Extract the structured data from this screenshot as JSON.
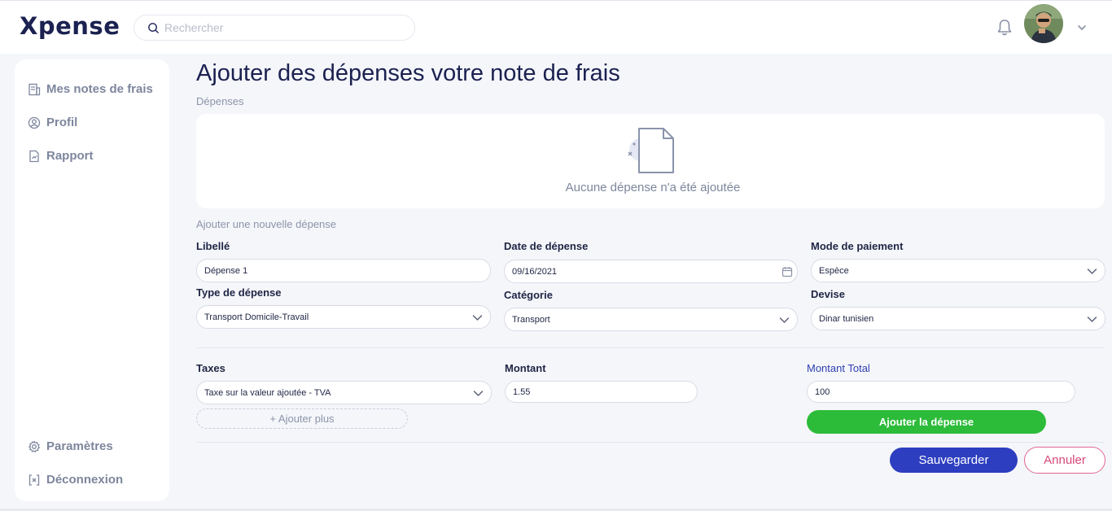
{
  "app": {
    "logo": "Xpense"
  },
  "search": {
    "placeholder": "Rechercher"
  },
  "sidebar": {
    "items": [
      {
        "label": "Mes notes de frais",
        "icon": "receipt-icon"
      },
      {
        "label": "Profil",
        "icon": "user-circle-icon"
      },
      {
        "label": "Rapport",
        "icon": "report-icon"
      }
    ],
    "bottom": [
      {
        "label": "Paramètres",
        "icon": "gear-icon"
      },
      {
        "label": "Déconnexion",
        "icon": "logout-icon"
      }
    ]
  },
  "page": {
    "title": "Ajouter des dépenses votre note de frais",
    "expenses_label": "Dépenses",
    "empty_text": "Aucune dépense n'a été ajoutée",
    "new_expense_label": "Ajouter une nouvelle dépense"
  },
  "form": {
    "libelle": {
      "label": "Libellé",
      "value": "Dépense 1"
    },
    "date": {
      "label": "Date de dépense",
      "value": "09/16/2021"
    },
    "mode": {
      "label": "Mode de paiement",
      "value": "Espèce"
    },
    "type": {
      "label": "Type de dépense",
      "value": "Transport Domicile-Travail"
    },
    "categorie": {
      "label": "Catégorie",
      "value": "Transport"
    },
    "devise": {
      "label": "Devise",
      "value": "Dinar tunisien"
    },
    "taxes": {
      "label": "Taxes",
      "value": "Taxe sur la valeur ajoutée - TVA"
    },
    "montant": {
      "label": "Montant",
      "value": "1.55"
    },
    "montant_total": {
      "label": "Montant Total",
      "value": "100"
    },
    "add_more": "+ Ajouter plus",
    "add_expense": "Ajouter la dépense"
  },
  "actions": {
    "save": "Sauvegarder",
    "cancel": "Annuler"
  },
  "colors": {
    "primary": "#2d3ec0",
    "success": "#2dbb3a",
    "danger": "#d9477a",
    "brand": "#1b2150"
  }
}
